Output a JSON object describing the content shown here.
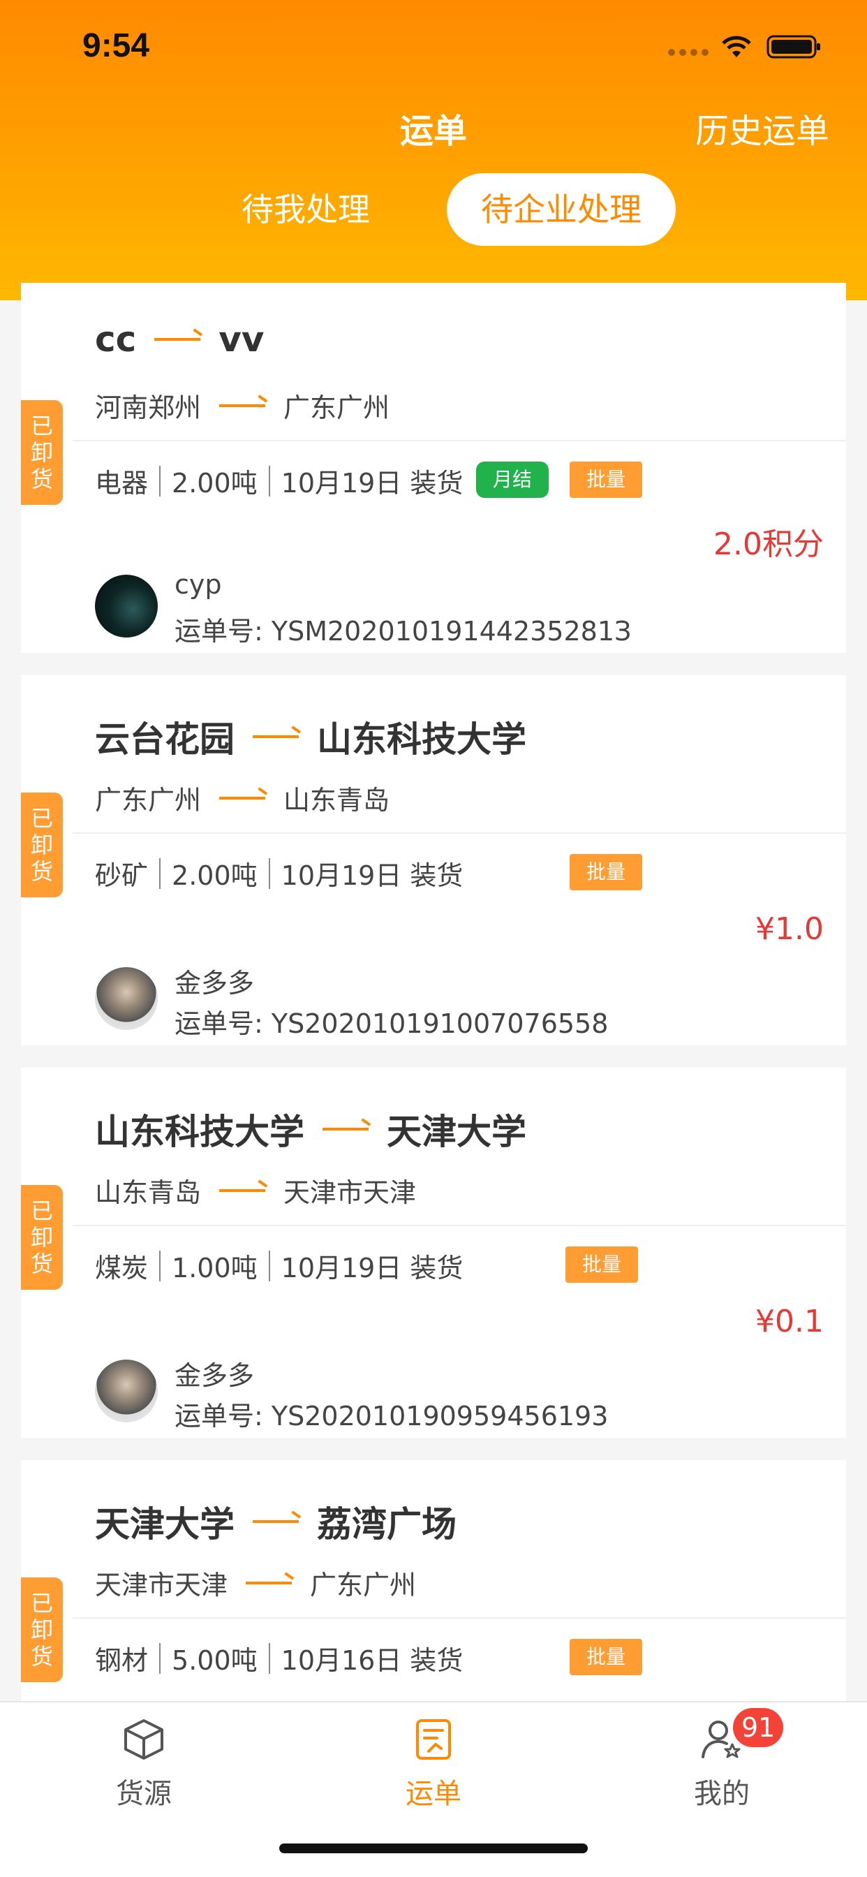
{
  "status_bar": {
    "time": "9:54"
  },
  "nav": {
    "title": "运单",
    "history": "历史运单"
  },
  "tabs": [
    {
      "label": "待我处理",
      "active": false
    },
    {
      "label": "待企业处理",
      "active": true
    }
  ],
  "orders": [
    {
      "status": [
        "已",
        "卸",
        "货"
      ],
      "from_name": "cc",
      "to_name": "vv",
      "from_city": "河南郑州",
      "to_city": "广东广州",
      "goods": "电器",
      "weight": "2.00吨",
      "load_date": "10月19日 装货",
      "settlement_tag": "月结",
      "batch_tag": "批量",
      "price": "2.0积分",
      "user": "cyp",
      "order_no": "运单号: YSM20201019144235281З"
    },
    {
      "status": [
        "已",
        "卸",
        "货"
      ],
      "from_name": "云台花园",
      "to_name": "山东科技大学",
      "from_city": "广东广州",
      "to_city": "山东青岛",
      "goods": "砂矿",
      "weight": "2.00吨",
      "load_date": "10月19日 装货",
      "batch_tag": "批量",
      "price": "¥1.0",
      "user": "金多多",
      "order_no": "运单号: YS20201019100707655​8"
    },
    {
      "status": [
        "已",
        "卸",
        "货"
      ],
      "from_name": "山东科技大学",
      "to_name": "天津大学",
      "from_city": "山东青岛",
      "to_city": "天津市天津",
      "goods": "煤炭",
      "weight": "1.00吨",
      "load_date": "10月19日 装货",
      "batch_tag": "批量",
      "price": "¥0.1",
      "user": "金多多",
      "order_no": "运单号: YS20201019095945619​3"
    },
    {
      "status": [
        "已",
        "卸",
        "货"
      ],
      "from_name": "天津大学",
      "to_name": "荔湾广场",
      "from_city": "天津市天津",
      "to_city": "广东广州",
      "goods": "钢材",
      "weight": "5.00吨",
      "load_date": "10月16日 装货",
      "batch_tag": "批量"
    }
  ],
  "tabbar": [
    {
      "label": "货源",
      "icon": "cube-icon",
      "active": false
    },
    {
      "label": "运单",
      "icon": "document-icon",
      "active": true
    },
    {
      "label": "我的",
      "icon": "user-star-icon",
      "active": false,
      "badge": "91"
    }
  ],
  "colors": {
    "accent": "#ff8a00",
    "price": "#e53935",
    "green": "#22b24c",
    "badge": "#ff9d33"
  }
}
